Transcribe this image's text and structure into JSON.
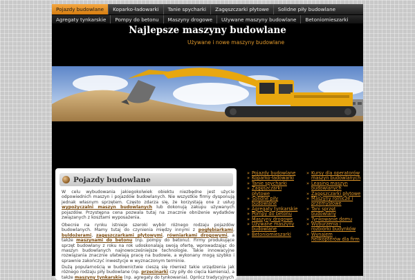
{
  "nav_primary": [
    "Pojazdy budowlane",
    "Koparko-ładowarki",
    "Tanie spycharki",
    "Zagęszczarki płytowe",
    "Solidne piły budowlane"
  ],
  "nav_secondary": [
    "Agregaty tynkarskie",
    "Pompy do betonu",
    "Maszyny drogowe",
    "Używane maszyny budowlane",
    "Betoniomieszarki"
  ],
  "header": {
    "title": "Najlepsze maszyny budowlane",
    "subtitle": "Używane i nowe maszyny budowlane"
  },
  "content": {
    "heading": "Pojazdy budowlane",
    "p1": {
      "t1": "W celu wybudowania jakiegokolwiek obiektu niezbędne jest użycie odpowiednich maszyn i pojazdów budowlanych. Nie wszystkie firmy dysponują jednak własnym sprzętem. Często zdarza się, że korzystają one z usług ",
      "link1": "wypożyczalni maszyn budowlanych",
      "t2": " lub dokonują zakupu używanych pojazdów. Przystępna cena pozwala tutaj na znacznie obniżenie wydatków związanych z kosztami wyposażenia."
    },
    "p2": {
      "t1": "Obecnie na rynku istnieje szeroki wybór różnego rodzaju pojazdów budowlanych. Mamy tutaj do czynienia między innymi z ",
      "link1": "pogłębiarkami",
      "t2": ", ",
      "link2": "buldożerami",
      "t3": ", ",
      "link3": "zagęszczarkami płytowymi",
      "t4": ", ",
      "link4": "równiarkami drogowymi",
      "t5": ", a także ",
      "link5": "maszynami do betonu",
      "t6": " (np. pompy do betonu). Firmy produkujące sprzęt budowlany z roku na rok udoskonalają swoją ofertę, wprowadzając do maszyn budowlanych najnowocześniejsze technologie. Takie innowacyjne rozwiązania znacznie ułatwiają pracę na budowie, a wykonany mogą szybko i sprawnie zakończyć inwestycje w wyznaczonym terminie."
    },
    "p3": {
      "t1": "Dużą popularnością w budownictwie cieszą się również takie urządzenia jak różnego rodzaju piły budowlane (np. ",
      "link1": "przecinarki",
      "t2": " czy piły do cięcia kamienia), a także ",
      "link2": "maszyny tynkarskie",
      "t3": " (np. agregaty do tynkowania). Oprócz tradycyjnych"
    }
  },
  "sidebar_left": [
    "Pojazdy budowlane",
    "Koparko-ładowarki",
    "Tanie spycharki",
    "Zagęszczarki płytowe",
    "Solidne piły budowlane",
    "Agregaty tynkarskie",
    "Pompy do betonu",
    "Maszyny drogowe",
    "Używane maszyny budowlane",
    "Betoniomieszarki"
  ],
  "sidebar_right": [
    "Kursy dla operatorów maszyn budowlanych",
    "Leasing maszyn budowlanych",
    "Zagęszczarki płytowe",
    "Maszyny rolnicze i przemysłowe",
    "Tani sprzęt budowlany",
    "Tynkowanie domu",
    "Wyburzenia i rozbiórki budynków",
    "Wynajem helikopterów dla firm"
  ],
  "icons": {
    "bullet": "chevron-right-icon",
    "heading": "machine-icon"
  },
  "colors": {
    "accent": "#e39a2c",
    "active_tab": "#e8931f",
    "background": "#000000",
    "link": "#7a4a0e"
  }
}
